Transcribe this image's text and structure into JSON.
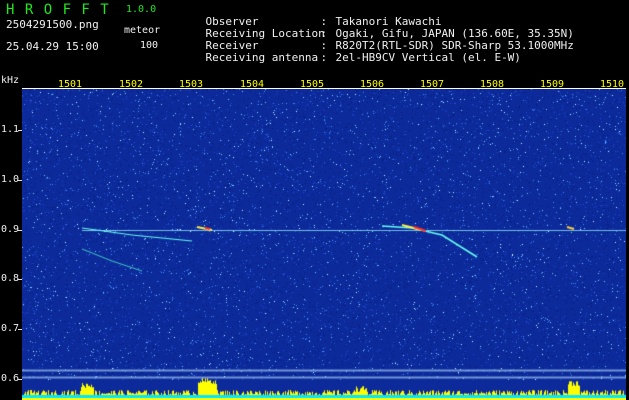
{
  "header": {
    "app_title": "H R O F F T",
    "app_version": "1.0.0",
    "file_name": "2504291500.png",
    "mode_label": "meteor",
    "timestamp": "25.04.29 15:00",
    "mode_value": "100"
  },
  "station_info": [
    {
      "label": "Observer",
      "value": "Takanori Kawachi"
    },
    {
      "label": "Receiving Location",
      "value": "Ogaki, Gifu, JAPAN (136.60E, 35.35N)"
    },
    {
      "label": "Receiver",
      "value": "R820T2(RTL-SDR) SDR-Sharp 53.1000MHz"
    },
    {
      "label": "Receiving antenna",
      "value": "2el-HB9CV Vertical (el. E-W)"
    }
  ],
  "axes": {
    "y_unit": "kHz",
    "y_ticks": [
      "1.1",
      "1.0",
      "0.9",
      "0.8",
      "0.7",
      "0.6"
    ],
    "x_ticks": [
      "1501",
      "1502",
      "1503",
      "1504",
      "1505",
      "1506",
      "1507",
      "1508",
      "1509",
      "1510"
    ]
  },
  "colors": {
    "title_green": "#1fe81f",
    "tick_yellow": "#ffff00",
    "noise_blue": "#0c2a9a",
    "signal_cyan": "#66ffee",
    "signal_red": "#ff3030"
  }
}
